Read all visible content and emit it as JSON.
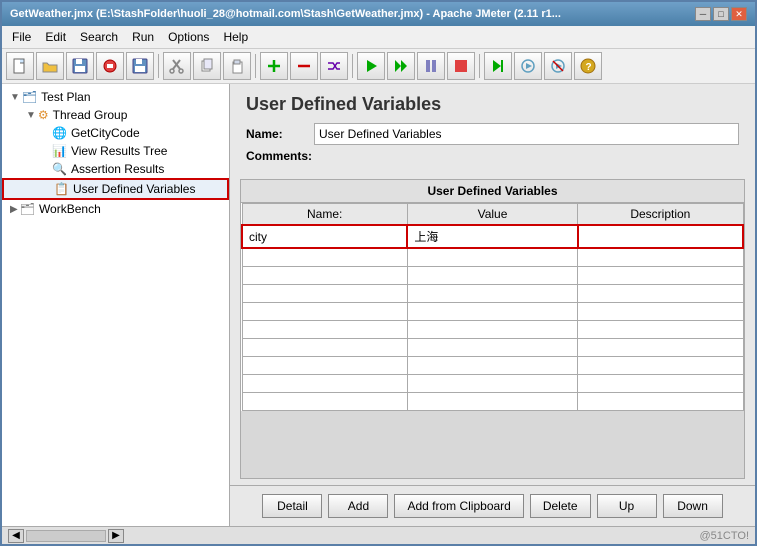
{
  "window": {
    "title": "GetWeather.jmx (E:\\StashFolder\\huoli_28@hotmail.com\\Stash\\GetWeather.jmx) - Apache JMeter (2.11 r1...",
    "min_label": "─",
    "max_label": "□",
    "close_label": "✕"
  },
  "menu": {
    "items": [
      "File",
      "Edit",
      "Search",
      "Run",
      "Options",
      "Help"
    ]
  },
  "toolbar": {
    "buttons": [
      "📄",
      "📂",
      "💾",
      "🚫",
      "💾",
      "📋",
      "✂️",
      "📋",
      "📄",
      "➕",
      "➖",
      "🔀",
      "▶",
      "▶▶",
      "⏸",
      "⏹",
      "▶",
      "⚡",
      "⚡",
      "🔧"
    ]
  },
  "tree": {
    "nodes": [
      {
        "id": "testplan",
        "label": "Test Plan",
        "indent": 0,
        "icon": "🗂",
        "expanded": true
      },
      {
        "id": "threadgroup",
        "label": "Thread Group",
        "indent": 1,
        "icon": "⚙",
        "expanded": true
      },
      {
        "id": "getcitycode",
        "label": "GetCityCode",
        "indent": 2,
        "icon": "🌐"
      },
      {
        "id": "viewresults",
        "label": "View Results Tree",
        "indent": 2,
        "icon": "📊"
      },
      {
        "id": "assertionresults",
        "label": "Assertion Results",
        "indent": 2,
        "icon": "🔍"
      },
      {
        "id": "uservars",
        "label": "User Defined Variables",
        "indent": 2,
        "icon": "📋",
        "selected": true,
        "highlighted": true
      },
      {
        "id": "workbench",
        "label": "WorkBench",
        "indent": 0,
        "icon": "🗂"
      }
    ]
  },
  "panel": {
    "title": "User Defined Variables",
    "name_label": "Name:",
    "name_value": "User Defined Variables",
    "comments_label": "Comments:",
    "table_title": "User Defined Variables",
    "columns": [
      "Name:",
      "Value",
      "Description"
    ],
    "rows": [
      {
        "name": "city",
        "value": "上海",
        "description": ""
      }
    ]
  },
  "buttons": {
    "detail": "Detail",
    "add": "Add",
    "add_clipboard": "Add from Clipboard",
    "delete": "Delete",
    "up": "Up",
    "down": "Down"
  },
  "statusbar": {
    "watermark": "@51CTO!",
    "scroll_left": "◀",
    "scroll_right": "▶"
  }
}
